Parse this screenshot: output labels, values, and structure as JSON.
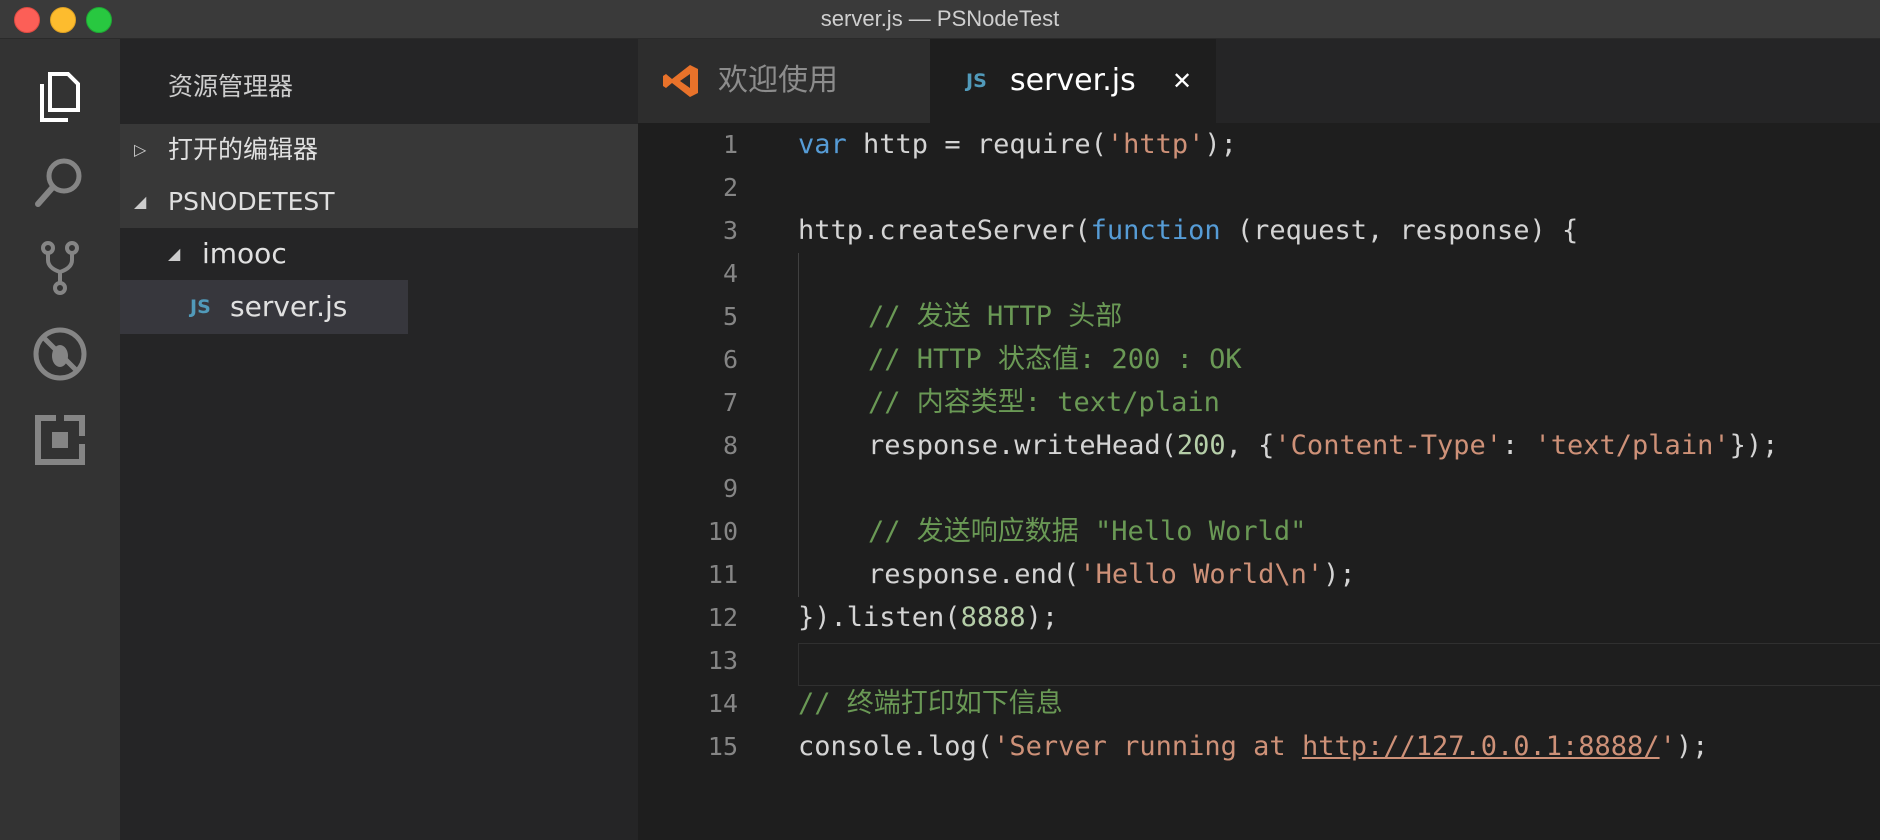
{
  "window": {
    "title": "server.js — PSNodeTest"
  },
  "activity_bar": [
    "explorer-icon",
    "search-icon",
    "source-control-icon",
    "debug-icon",
    "extensions-icon"
  ],
  "sidebar": {
    "title": "资源管理器",
    "open_editors_label": "打开的编辑器",
    "project_label": "PSNODETEST",
    "folder_label": "imooc",
    "file_badge": "JS",
    "file_label": "server.js"
  },
  "tabs": {
    "welcome_label": "欢迎使用",
    "server_badge": "JS",
    "server_label": "server.js",
    "close_glyph": "✕"
  },
  "editor": {
    "line_numbers": [
      "1",
      "2",
      "3",
      "4",
      "5",
      "6",
      "7",
      "8",
      "9",
      "10",
      "11",
      "12",
      "13",
      "14",
      "15"
    ],
    "l1": {
      "kw": "var",
      "a": " http = require(",
      "s": "'http'",
      "b": ");"
    },
    "l3": {
      "a": "http.createServer(",
      "kw": "function",
      "b": " (request, response) {"
    },
    "l5": "// 发送 HTTP 头部",
    "l6": "// HTTP 状态值: 200 : OK",
    "l7": "// 内容类型: text/plain",
    "l8": {
      "a": "response.writeHead(",
      "n": "200",
      "b": ", {",
      "s1": "'Content-Type'",
      "c": ": ",
      "s2": "'text/plain'",
      "d": "});"
    },
    "l10": "// 发送响应数据 \"Hello World\"",
    "l11": {
      "a": "response.end(",
      "s": "'Hello World\\n'",
      "b": ");"
    },
    "l12": {
      "a": "}).listen(",
      "n": "8888",
      "b": ");"
    },
    "l14": "// 终端打印如下信息",
    "l15": {
      "a": "console.log(",
      "s1": "'Server running at ",
      "url": "http://127.0.0.1:8888/",
      "s2": "'",
      "b": ");"
    }
  },
  "colors": {
    "keyword": "#569cd6",
    "string": "#ce9178",
    "number": "#b5cea8",
    "comment": "#6a9955",
    "js_badge": "#519aba"
  }
}
